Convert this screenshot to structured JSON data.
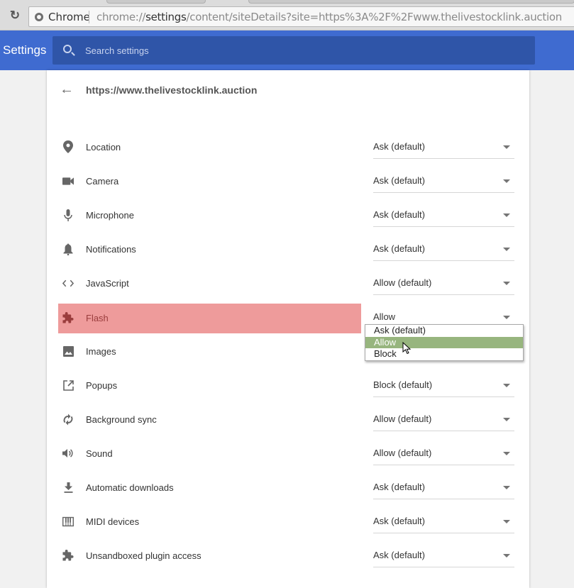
{
  "browser": {
    "chip_label": "Chrome",
    "url_prefix": "chrome://",
    "url_host": "settings",
    "url_path": "/content/siteDetails?site=https%3A%2F%2Fwww.thelivestocklink.auction",
    "reload_icon": "reload-icon"
  },
  "header": {
    "title": "Settings",
    "search_placeholder": "Search settings",
    "brand_color": "#3f6bd0"
  },
  "site": {
    "title": "https://www.thelivestocklink.auction"
  },
  "permissions": [
    {
      "label": "Location",
      "value": "Ask (default)",
      "icon": "location-pin-icon"
    },
    {
      "label": "Camera",
      "value": "Ask (default)",
      "icon": "camera-icon"
    },
    {
      "label": "Microphone",
      "value": "Ask (default)",
      "icon": "microphone-icon"
    },
    {
      "label": "Notifications",
      "value": "Ask (default)",
      "icon": "bell-icon"
    },
    {
      "label": "JavaScript",
      "value": "Allow (default)",
      "icon": "code-icon"
    },
    {
      "label": "Flash",
      "value": "Allow",
      "icon": "puzzle-icon",
      "highlighted": true
    },
    {
      "label": "Images",
      "value": "",
      "icon": "image-icon"
    },
    {
      "label": "Popups",
      "value": "Block (default)",
      "icon": "open-in-new-icon"
    },
    {
      "label": "Background sync",
      "value": "Allow (default)",
      "icon": "sync-icon"
    },
    {
      "label": "Sound",
      "value": "Allow (default)",
      "icon": "volume-icon"
    },
    {
      "label": "Automatic downloads",
      "value": "Ask (default)",
      "icon": "download-icon"
    },
    {
      "label": "MIDI devices",
      "value": "Ask (default)",
      "icon": "piano-icon"
    },
    {
      "label": "Unsandboxed plugin access",
      "value": "Ask (default)",
      "icon": "puzzle-icon"
    }
  ],
  "flash_dropdown": {
    "options": [
      "Ask (default)",
      "Allow",
      "Block"
    ],
    "hovered": "Allow",
    "hover_color": "#97b57e"
  },
  "highlight_color": "#ee9b9b"
}
